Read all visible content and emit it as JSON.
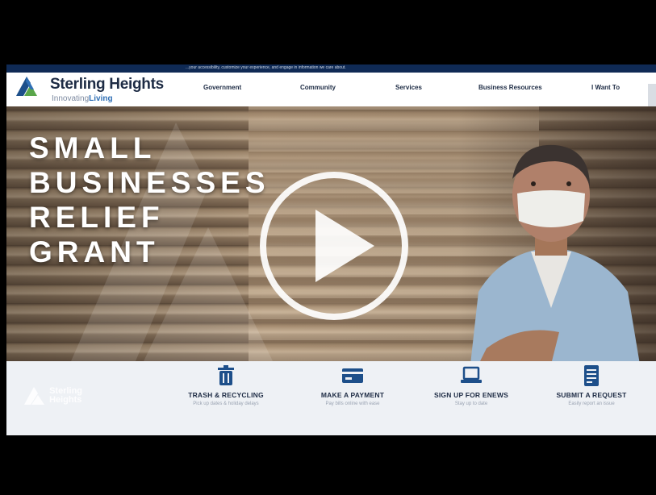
{
  "topbar": {
    "notice": "...your accessibility, customize your experience, and engage in information we care about."
  },
  "logo": {
    "name": "Sterling Heights",
    "tag_prefix": "Innovating",
    "tag_emphasis": "Living"
  },
  "nav": [
    "Government",
    "Community",
    "Services",
    "Business Resources",
    "I Want To"
  ],
  "hero": {
    "headline_lines": [
      "SMALL",
      "BUSINESSES",
      "RELIEF",
      "GRANT"
    ]
  },
  "quick_links": [
    {
      "icon": "trash-icon",
      "title": "TRASH & RECYCLING",
      "subtitle": "Pick up dates & holiday delays"
    },
    {
      "icon": "payment-card-icon",
      "title": "MAKE A PAYMENT",
      "subtitle": "Pay bills online with ease"
    },
    {
      "icon": "laptop-icon",
      "title": "SIGN UP FOR ENEWS",
      "subtitle": "Stay up to date"
    },
    {
      "icon": "document-icon",
      "title": "SUBMIT A REQUEST",
      "subtitle": "Easily report an issue"
    }
  ],
  "footer_logo": {
    "name_line1": "Sterling",
    "name_line2": "Heights"
  },
  "colors": {
    "navy": "#0f2a55",
    "brand_blue": "#2f6fb5",
    "accent_green": "#5aa64a"
  }
}
